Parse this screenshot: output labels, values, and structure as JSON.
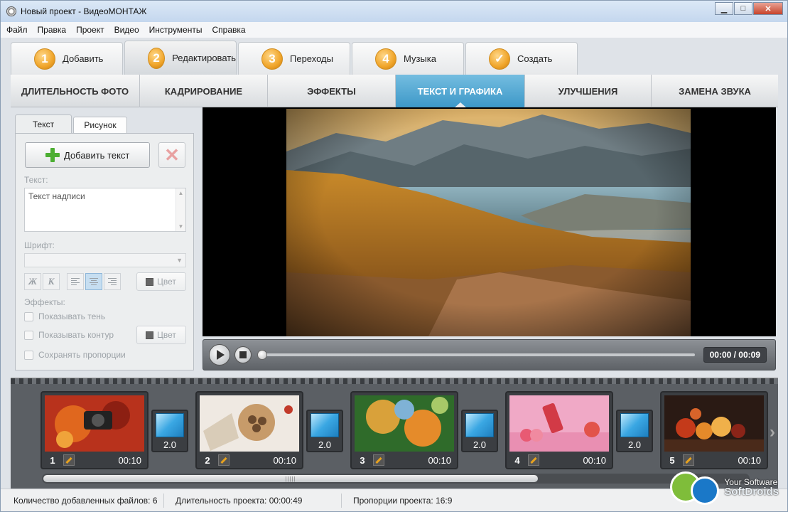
{
  "window": {
    "title": "Новый проект - ВидеоМОНТАЖ",
    "minimize": "▁",
    "maximize": "□",
    "close": "✕"
  },
  "menu": [
    "Файл",
    "Правка",
    "Проект",
    "Видео",
    "Инструменты",
    "Справка"
  ],
  "steps": [
    {
      "num": "1",
      "label": "Добавить"
    },
    {
      "num": "2",
      "label": "Редактировать",
      "active": true
    },
    {
      "num": "3",
      "label": "Переходы"
    },
    {
      "num": "4",
      "label": "Музыка"
    },
    {
      "num": "✓",
      "label": "Создать"
    }
  ],
  "subtabs": [
    "ДЛИТЕЛЬНОСТЬ ФОТО",
    "КАДРИРОВАНИЕ",
    "ЭФФЕКТЫ",
    "ТЕКСТ И ГРАФИКА",
    "УЛУЧШЕНИЯ",
    "ЗАМЕНА ЗВУКА"
  ],
  "active_subtab": "ТЕКСТ И ГРАФИКА",
  "panel": {
    "tabs": [
      "Текст",
      "Рисунок"
    ],
    "add_text": "Добавить текст",
    "text_label": "Текст:",
    "text_value": "Текст надписи",
    "font_label": "Шрифт:",
    "bold": "Ж",
    "italic": "К",
    "color": "Цвет",
    "effects_label": "Эффекты:",
    "show_shadow": "Показывать тень",
    "show_outline": "Показывать контур",
    "outline_color": "Цвет",
    "keep_proportions": "Сохранять пропорции"
  },
  "player": {
    "time": "00:00 / 00:09",
    "progress": 0
  },
  "slides": [
    {
      "num": "1",
      "duration": "00:10"
    },
    {
      "num": "2",
      "duration": "00:10"
    },
    {
      "num": "3",
      "duration": "00:10"
    },
    {
      "num": "4",
      "duration": "00:10"
    },
    {
      "num": "5",
      "duration": "00:10"
    }
  ],
  "transitions": [
    "2.0",
    "2.0",
    "2.0",
    "2.0"
  ],
  "status": {
    "files": "Количество добавленных файлов: 6",
    "duration": "Длительность проекта:   00:00:49",
    "proportions": "Пропорции проекта:   16:9"
  },
  "watermark": {
    "line1": "Your Software",
    "line2": "SoftDroids"
  }
}
